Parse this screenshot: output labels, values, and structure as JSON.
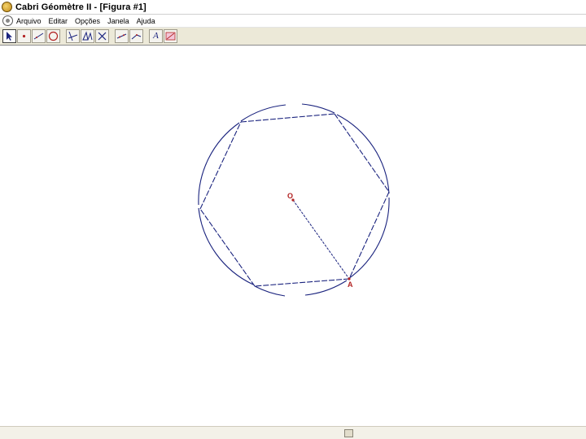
{
  "window": {
    "title": "Cabri Géomètre II - [Figura  #1]"
  },
  "menu": {
    "items": [
      {
        "label": "Arquivo"
      },
      {
        "label": "Editar"
      },
      {
        "label": "Opções"
      },
      {
        "label": "Janela"
      },
      {
        "label": "Ajuda"
      }
    ]
  },
  "toolbar": {
    "tools": [
      {
        "icon": "pointer-icon"
      },
      {
        "icon": "point-icon"
      },
      {
        "icon": "line-icon"
      },
      {
        "icon": "circle-icon"
      },
      {
        "icon": "perpendicular-icon"
      },
      {
        "icon": "transformation-icon"
      },
      {
        "icon": "macro-icon"
      },
      {
        "icon": "property-icon"
      },
      {
        "icon": "measure-icon"
      },
      {
        "icon": "text-label-icon",
        "label": "A"
      },
      {
        "icon": "attribute-icon"
      }
    ]
  },
  "figure": {
    "center_label": "O",
    "vertex_label": "A",
    "point_color": "#b22222",
    "stroke_color": "#1a237e"
  }
}
